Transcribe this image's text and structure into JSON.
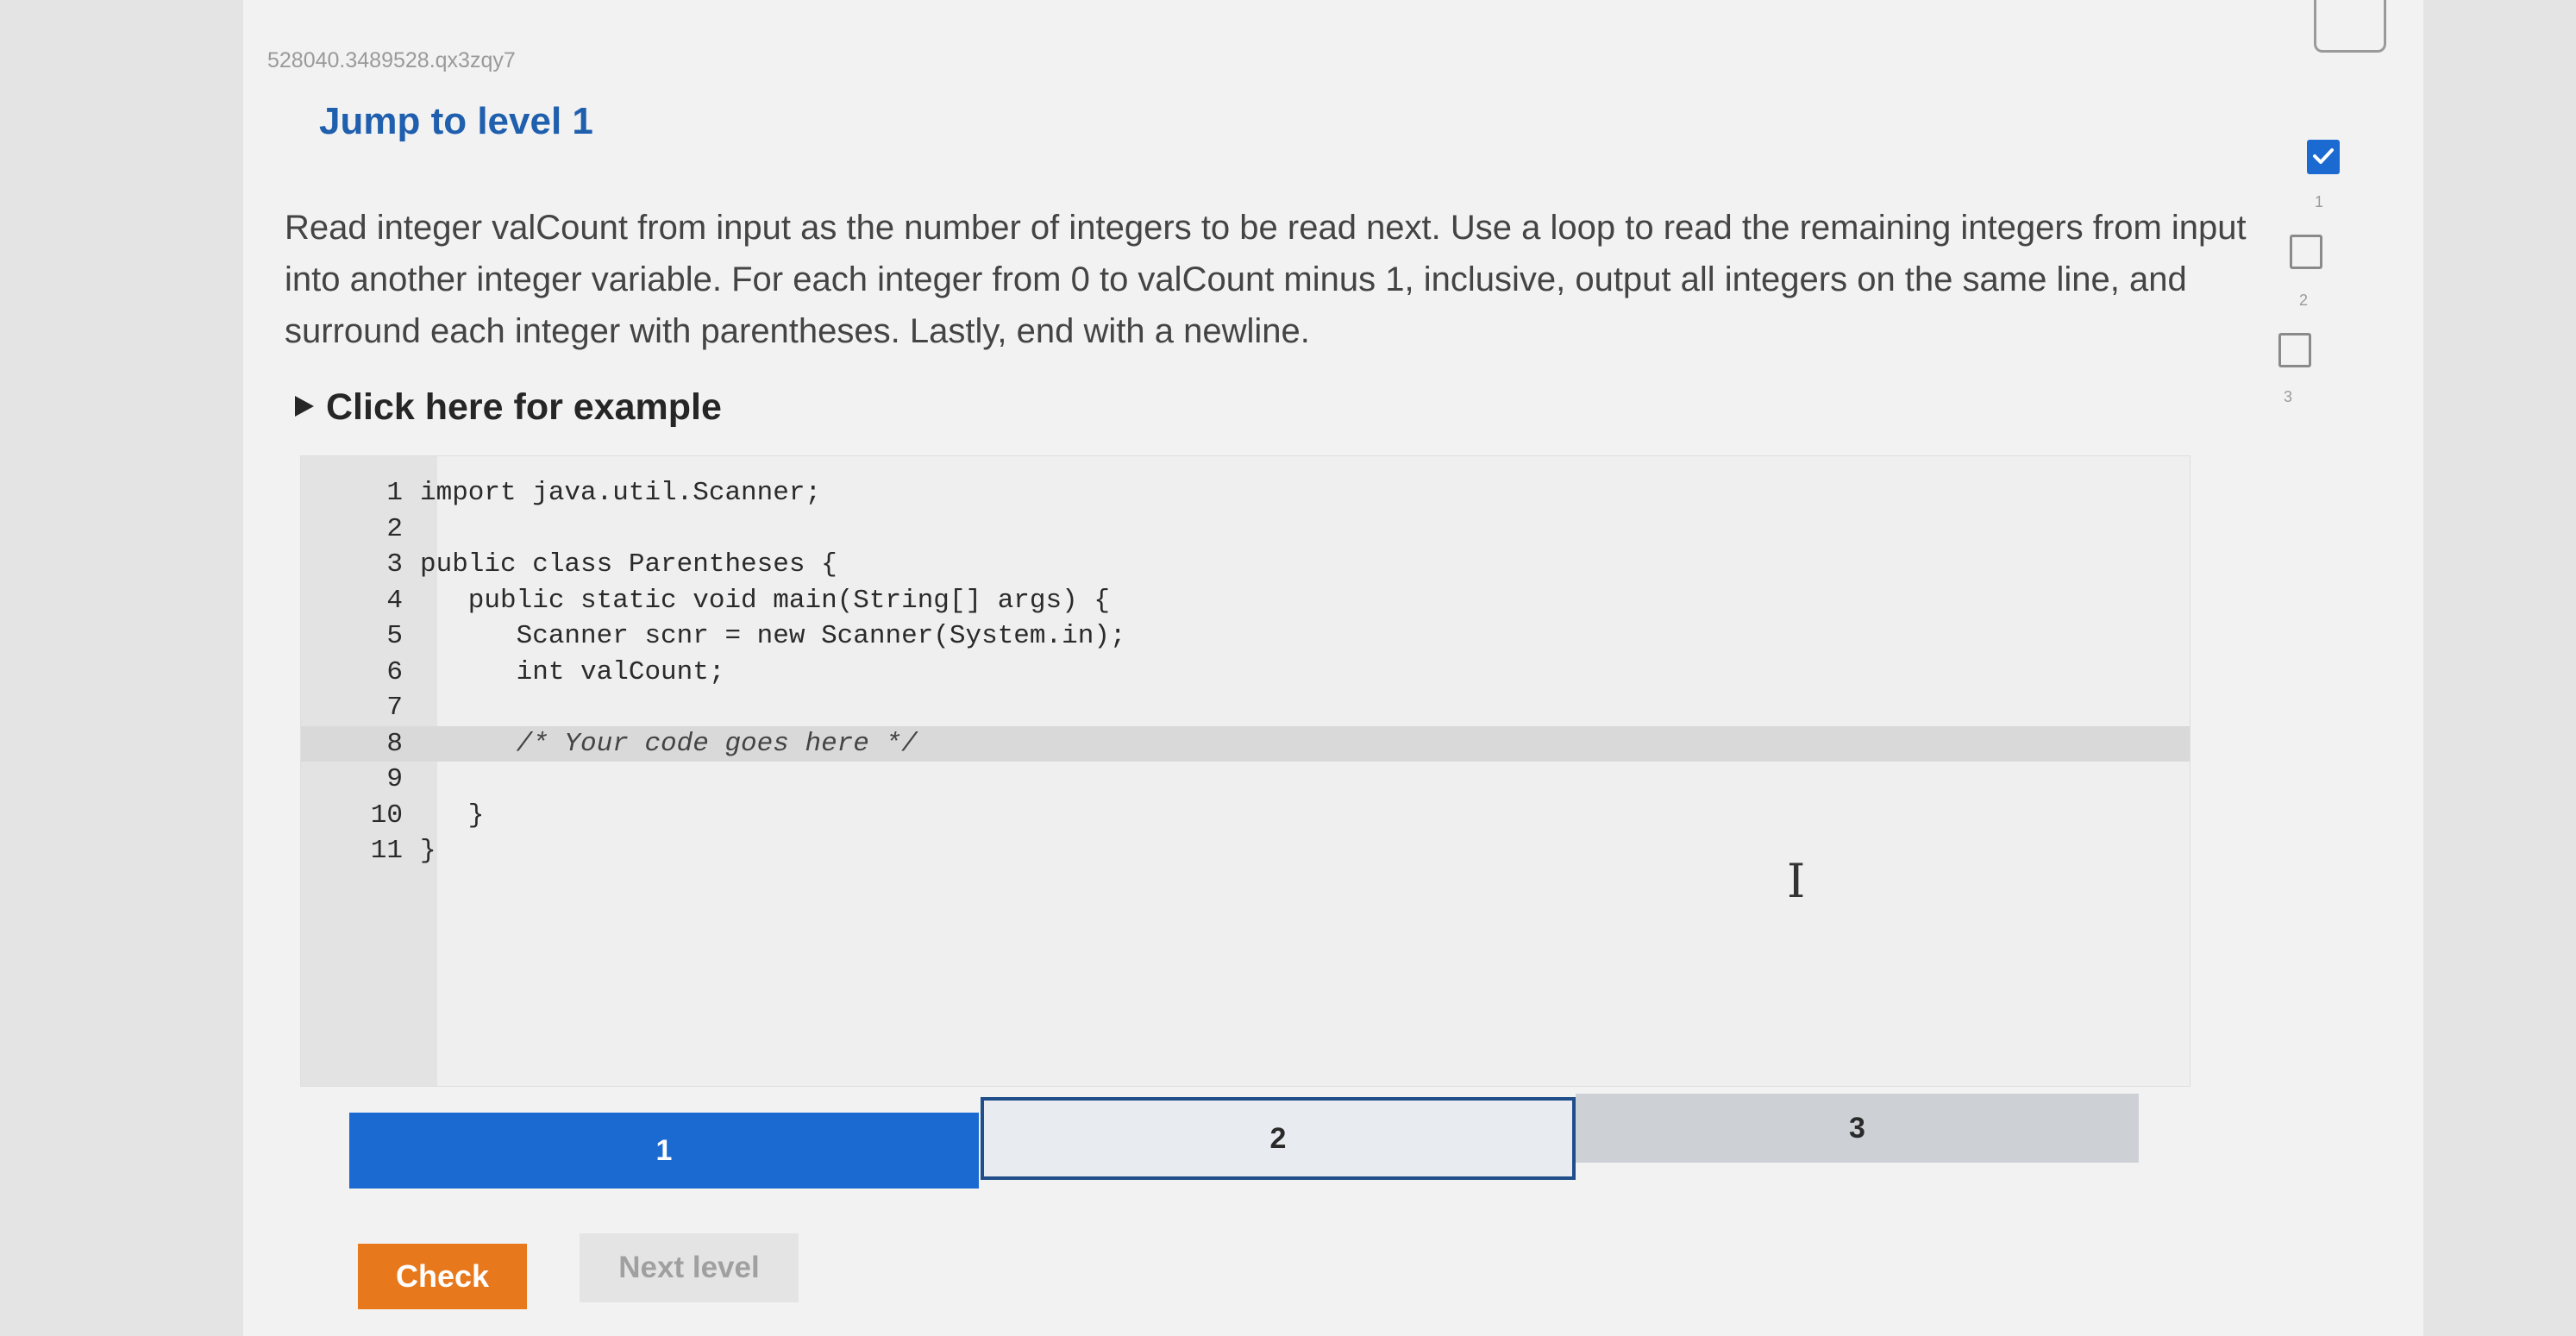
{
  "activity": {
    "id": "528040.3489528.qx3zqy7",
    "title": "Jump to level 1",
    "prompt": "Read integer valCount from input as the number of integers to be read next. Use a loop to read the remaining integers from input into another integer variable. For each integer from 0 to valCount minus 1, inclusive, output all integers on the same line, and surround each integer with parentheses. Lastly, end with a newline.",
    "example_toggle": "Click here for example"
  },
  "editor": {
    "lines": [
      {
        "num": "1",
        "code": "import java.util.Scanner;"
      },
      {
        "num": "2",
        "code": ""
      },
      {
        "num": "3",
        "code": "public class Parentheses {"
      },
      {
        "num": "4",
        "code": "   public static void main(String[] args) {"
      },
      {
        "num": "5",
        "code": "      Scanner scnr = new Scanner(System.in);"
      },
      {
        "num": "6",
        "code": "      int valCount;"
      },
      {
        "num": "7",
        "code": ""
      },
      {
        "num": "8",
        "code": "      /* Your code goes here */"
      },
      {
        "num": "9",
        "code": ""
      },
      {
        "num": "10",
        "code": "   }"
      },
      {
        "num": "11",
        "code": "}"
      }
    ],
    "active_line": "8"
  },
  "levels": [
    {
      "label": "1",
      "state": "current"
    },
    {
      "label": "2",
      "state": "selected"
    },
    {
      "label": "3",
      "state": "locked"
    }
  ],
  "buttons": {
    "check": "Check",
    "next_level": "Next level"
  },
  "side_progress": [
    {
      "label": "1",
      "completed": true
    },
    {
      "label": "2",
      "completed": false
    },
    {
      "label": "3",
      "completed": false
    }
  ],
  "colors": {
    "accent_blue": "#1b6ad1",
    "title_blue": "#1f5fae",
    "check_orange": "#e8781c"
  }
}
